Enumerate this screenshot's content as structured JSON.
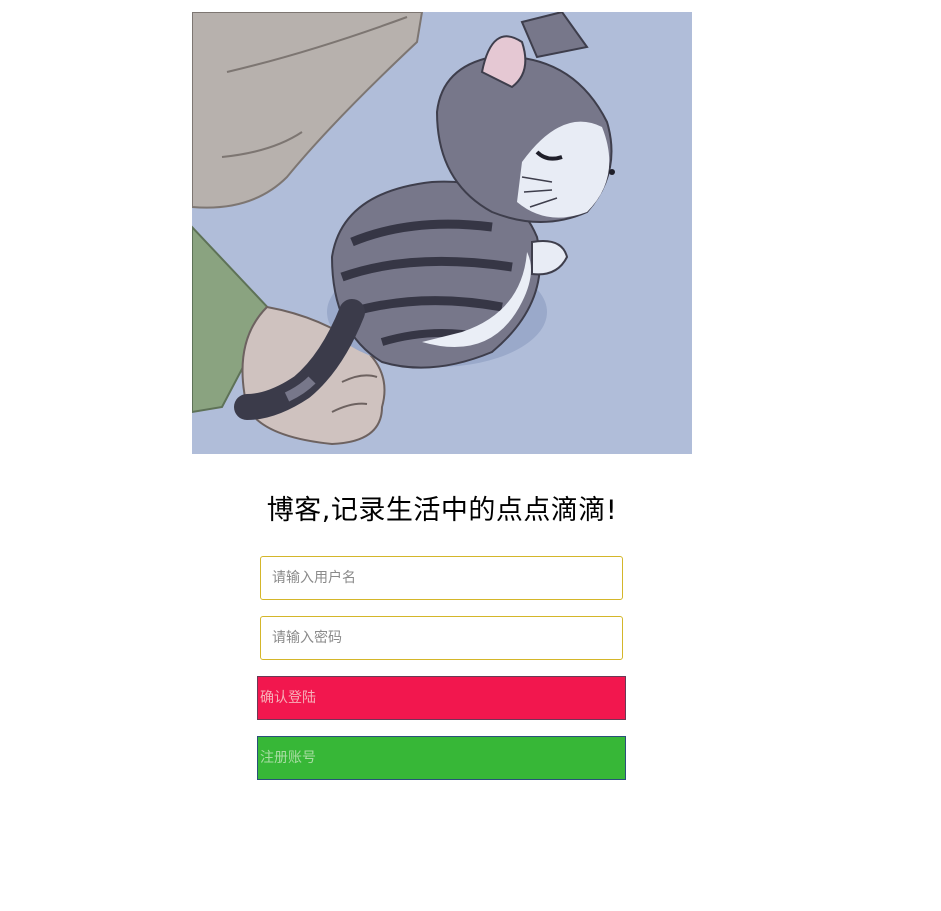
{
  "hero": {
    "alt": "sleeping cartoon kitten"
  },
  "slogan": "博客,记录生活中的点点滴滴!",
  "form": {
    "username_placeholder": "请输入用户名",
    "username_value": "",
    "password_placeholder": "请输入密码",
    "password_value": "",
    "login_label": "确认登陆",
    "register_label": "注册账号"
  },
  "colors": {
    "login_bg": "#f2174e",
    "register_bg": "#37b737",
    "field_border": "#d4b62a"
  }
}
